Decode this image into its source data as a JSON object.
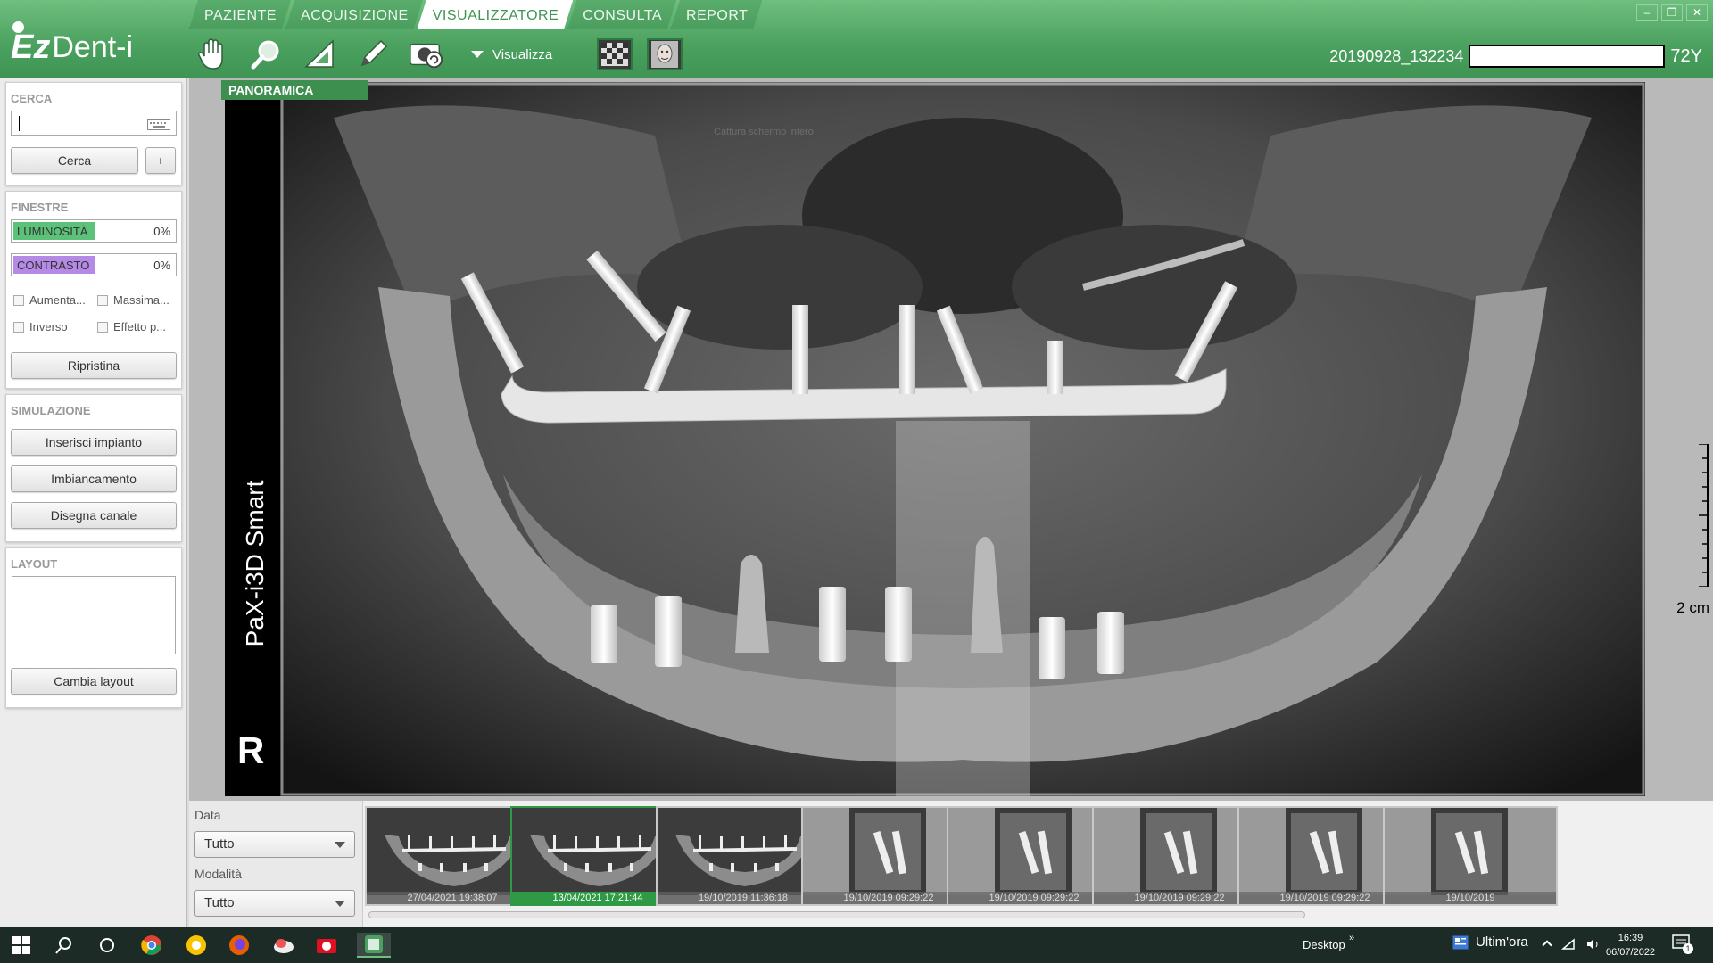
{
  "app": {
    "logo_ez": "Ez",
    "logo_dent": "Dent-i"
  },
  "tabs": [
    {
      "label": "PAZIENTE"
    },
    {
      "label": "ACQUISIZIONE"
    },
    {
      "label": "VISUALIZZATORE",
      "active": true
    },
    {
      "label": "CONSULTA"
    },
    {
      "label": "REPORT"
    }
  ],
  "toolbar": {
    "icons": [
      "hand-pan-icon",
      "magnifier-icon",
      "ruler-angle-icon",
      "pencil-icon",
      "camera-capture-icon"
    ],
    "visualizza_label": "Visualizza"
  },
  "window_controls": [
    "–",
    "❐",
    "✕"
  ],
  "patient": {
    "id": "20190928_132234",
    "age": "72Y"
  },
  "left": {
    "search": {
      "title": "CERCA",
      "value": "",
      "button": "Cerca",
      "add": "+"
    },
    "windows": {
      "title": "FINESTRE",
      "brightness": {
        "label": "LUMINOSITÀ",
        "value": "0%",
        "color": "#5cc27a"
      },
      "contrast": {
        "label": "CONTRASTO",
        "value": "0%",
        "color": "#b48ae6"
      },
      "checks": [
        "Aumenta...",
        "Massima...",
        "Inverso",
        "Effetto p..."
      ],
      "reset": "Ripristina"
    },
    "simulation": {
      "title": "SIMULAZIONE",
      "buttons": [
        "Inserisci impianto",
        "Imbiancamento",
        "Disegna canale"
      ]
    },
    "layout": {
      "title": "LAYOUT",
      "button": "Cambia layout"
    }
  },
  "viewer": {
    "title": "PANORAMICA",
    "device": "PaX-i3D Smart",
    "side": "R",
    "ghost_tooltip": "Cattura schermo intero",
    "scale_label": "2 cm"
  },
  "filters": {
    "date_label": "Data",
    "date_value": "Tutto",
    "modality_label": "Modalità",
    "modality_value": "Tutto"
  },
  "thumbnails": [
    {
      "date": "27/04/2021 19:38:07",
      "kind": "pano"
    },
    {
      "date": "13/04/2021 17:21:44",
      "kind": "pano",
      "selected": true
    },
    {
      "date": "19/10/2019 11:36:18",
      "kind": "pano"
    },
    {
      "date": "19/10/2019 09:29:22",
      "kind": "intra"
    },
    {
      "date": "19/10/2019 09:29:22",
      "kind": "intra"
    },
    {
      "date": "19/10/2019 09:29:22",
      "kind": "intra"
    },
    {
      "date": "19/10/2019 09:29:22",
      "kind": "intra"
    },
    {
      "date": "19/10/2019",
      "kind": "intra"
    }
  ],
  "taskbar": {
    "desktop": "Desktop",
    "news": "Ultim'ora",
    "time": "16:39",
    "date": "06/07/2022",
    "notif": "1"
  }
}
